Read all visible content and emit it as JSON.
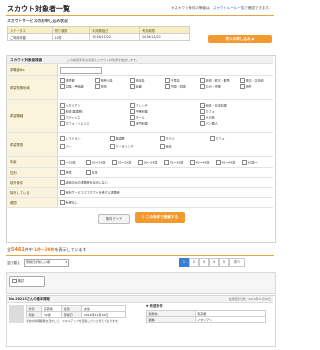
{
  "page_title": "スカウト対象者一覧",
  "top_note": {
    "prefix": "※スカウト条件の警報は、",
    "link": "スカウトルール一覧",
    "suffix": "で確認できます。"
  },
  "status_section": {
    "title": "スカウトサービスのお申し込み状況",
    "headers": [
      "ステータス",
      "残り通数",
      "利用開始日",
      "有効期限"
    ],
    "values": [
      "ご利用可能",
      "10件",
      "2016/11/22",
      "2016/12/20"
    ],
    "button": "求人の申し込み ▶"
  },
  "search": {
    "header": "スカウト対象者検索",
    "header_note": "この検索条件は次回もスカウト対象者を抽出します。",
    "fields": [
      {
        "label": "求職者No.",
        "type": "input"
      },
      {
        "label": "希望勤務地域",
        "options": [
          "東京都",
          "神奈川県",
          "埼玉県",
          "千葉県",
          "茨城・栃木・群馬",
          "東北・北海道",
          "北陸・甲信越",
          "東海",
          "近畿",
          "中国・四国",
          "九州・沖縄",
          "海外"
        ]
      },
      {
        "label": "希望職種",
        "options": [
          "イタリアン",
          "フレンチ",
          "和食・日本料理",
          "和食(居酒屋)",
          "中華料理",
          "カフェ",
          "パティシエ",
          "ホール",
          "その他",
          "カフェ・ソムリエ",
          "専門料理",
          "パン職人"
        ]
      },
      {
        "label": "希望業態",
        "options": [
          "レストラン",
          "居酒屋",
          "ホテル",
          "カフェ",
          "バー",
          "ケータリング",
          "給食"
        ]
      },
      {
        "label": "年齢",
        "options": [
          "〜19歳",
          "20〜24歳",
          "25〜29歳",
          "30〜34歳",
          "35〜39歳",
          "40〜44歳",
          "45〜49歳",
          "50歳〜"
        ]
      },
      {
        "label": "性別",
        "options": [
          "男性",
          "女性"
        ]
      },
      {
        "label": "除外条件",
        "options": [
          "送信済みの求職者を表示しない"
        ]
      },
      {
        "label": "除外している",
        "options": [
          "有料サービスでスカウトを受ける求職者"
        ]
      },
      {
        "label": "期間",
        "options": [
          "新規なし"
        ]
      }
    ],
    "clear_button": "条件クリア",
    "search_button": "この条件で検索する"
  },
  "results": {
    "total_label": "全",
    "total": "5461",
    "total_unit": "件中",
    "range": "1件～20件",
    "range_suffix": "を表示しています",
    "sort_label": "並び替え",
    "sort_value": "登録日が新しい順",
    "pages": [
      "1",
      "2",
      "3",
      "4",
      "5",
      "次へ"
    ]
  },
  "candidate": {
    "checkbox_label": "検討",
    "name": "No.26213さんの基本情報",
    "updated": "最終更新日時：2016年11月18日",
    "table": [
      [
        "状況",
        "応募者",
        "性別",
        "女性"
      ],
      [
        "年齢",
        "30歳",
        "登録日",
        "2016年11月18日"
      ]
    ],
    "desired_title": "▼ 希望条件",
    "desired": [
      [
        "勤務地",
        "東京都"
      ],
      [
        "職種",
        "イタリアン"
      ]
    ],
    "note": "手前の料理経験を活かして、スキルアップを目指したいと考えております。"
  }
}
